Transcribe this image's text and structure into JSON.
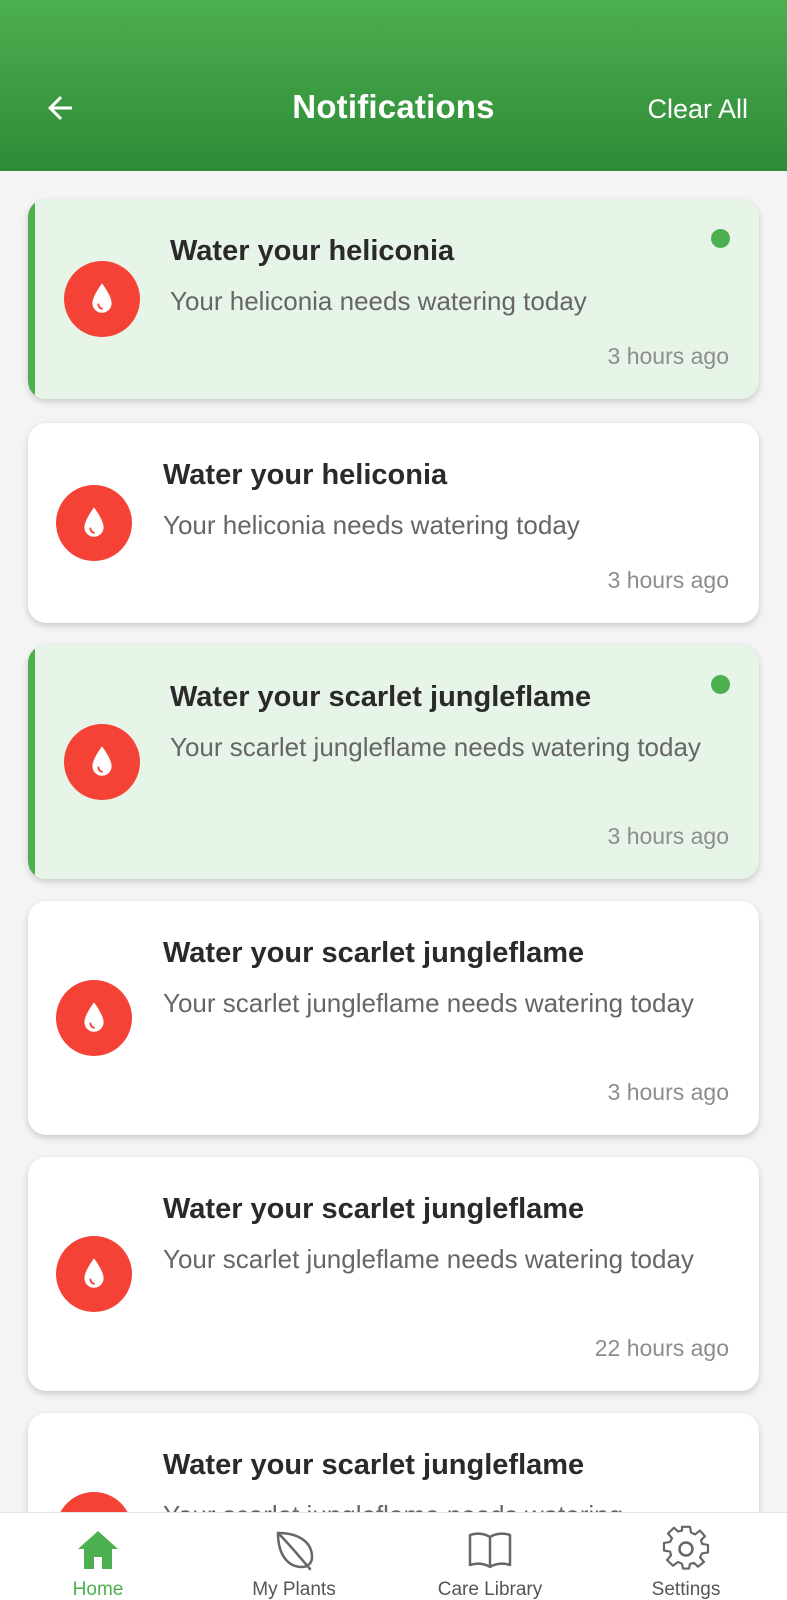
{
  "header": {
    "title": "Notifications",
    "clear_all_label": "Clear All"
  },
  "notifications": [
    {
      "title": "Water your heliconia",
      "body": "Your heliconia needs watering today",
      "time": "3 hours ago",
      "unread": true,
      "icon": "water-drop-icon"
    },
    {
      "title": "Water your heliconia",
      "body": "Your heliconia needs watering today",
      "time": "3 hours ago",
      "unread": false,
      "icon": "water-drop-icon"
    },
    {
      "title": "Water your scarlet jungleflame",
      "body": "Your scarlet jungleflame needs watering today",
      "time": "3 hours ago",
      "unread": true,
      "icon": "water-drop-icon"
    },
    {
      "title": "Water your scarlet jungleflame",
      "body": "Your scarlet jungleflame needs watering today",
      "time": "3 hours ago",
      "unread": false,
      "icon": "water-drop-icon"
    },
    {
      "title": "Water your scarlet jungleflame",
      "body": "Your scarlet jungleflame needs watering today",
      "time": "22 hours ago",
      "unread": false,
      "icon": "water-drop-icon"
    },
    {
      "title": "Water your scarlet jungleflame",
      "body": "Your scarlet jungleflame needs watering",
      "time": "",
      "unread": false,
      "icon": "water-drop-icon"
    }
  ],
  "bottom_nav": {
    "items": [
      {
        "label": "Home",
        "icon": "home-icon",
        "active": true
      },
      {
        "label": "My Plants",
        "icon": "leaf-icon",
        "active": false
      },
      {
        "label": "Care Library",
        "icon": "book-icon",
        "active": false
      },
      {
        "label": "Settings",
        "icon": "gear-icon",
        "active": false
      }
    ]
  },
  "colors": {
    "primary_green": "#4caf50",
    "header_dark_green": "#2e8b36",
    "unread_card_bg": "#e7f4e8",
    "icon_red": "#f44336"
  }
}
